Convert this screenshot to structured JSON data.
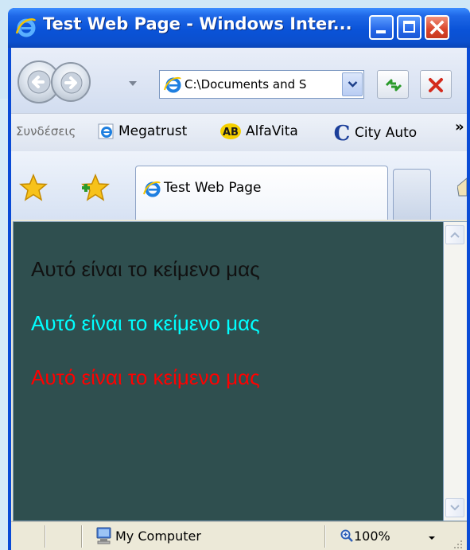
{
  "window": {
    "title": "Test Web Page - Windows Inter..."
  },
  "navbar": {
    "address": "C:\\Documents and S"
  },
  "links": {
    "label": "Συνδέσεις",
    "items": [
      {
        "label": "Megatrust"
      },
      {
        "label": "AlfaVita",
        "badge": "AB"
      },
      {
        "label": "City Auto",
        "badge": "C"
      }
    ],
    "more": "»"
  },
  "tabs": {
    "active_label": "Test Web Page"
  },
  "content": {
    "lines": [
      {
        "text": "Αυτό είναι το κείμενο μας",
        "color": "#111111"
      },
      {
        "text": "Αυτό είναι το κείμενο μας",
        "color": "#00ffff"
      },
      {
        "text": "Αυτό είναι το κείμενο μας",
        "color": "#ff0000"
      }
    ],
    "background": "#2f4f4f"
  },
  "status": {
    "zone": "My Computer",
    "zoom": "100%"
  }
}
